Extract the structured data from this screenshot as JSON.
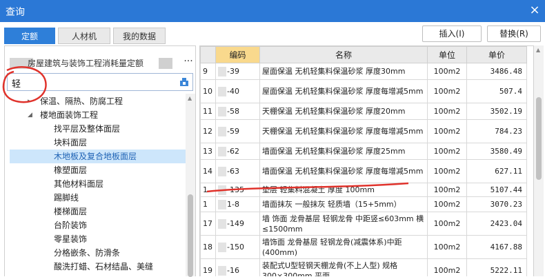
{
  "window": {
    "title": "查询",
    "close_glyph": "×"
  },
  "tabs": [
    {
      "label": "定额",
      "active": true
    },
    {
      "label": "人材机",
      "active": false
    },
    {
      "label": "我的数据",
      "active": false
    }
  ],
  "buttons": {
    "insert": "插入(I)",
    "replace": "替换(R)"
  },
  "library": {
    "name": "房屋建筑与装饰工程消耗量定额",
    "more": "···"
  },
  "search": {
    "value": "轻"
  },
  "tree": [
    {
      "label": "保温、隔热、防腐工程",
      "arrow": "▸"
    },
    {
      "label": "楼地面装饰工程",
      "arrow": "◢"
    },
    {
      "label": "找平层及整体面层"
    },
    {
      "label": "块料面层"
    },
    {
      "label": "木地板及复合地板面层"
    },
    {
      "label": "橡塑面层"
    },
    {
      "label": "其他材料面层"
    },
    {
      "label": "踢脚线"
    },
    {
      "label": "楼梯面层"
    },
    {
      "label": "台阶装饰"
    },
    {
      "label": "零星装饰"
    },
    {
      "label": "分格嵌条、防滑条"
    },
    {
      "label": "酸洗打蜡、石材结晶、美缝"
    }
  ],
  "table": {
    "columns": [
      "",
      "编码",
      "名称",
      "单位",
      "单价"
    ],
    "rows": [
      {
        "idx": "9",
        "code": "-39",
        "name": "屋面保温 无机轻集料保温砂浆 厚度30mm",
        "unit": "100m2",
        "price": "3486.48"
      },
      {
        "idx": "10",
        "code": "-40",
        "name": "屋面保温 无机轻集料保温砂浆 厚度每增减5mm",
        "unit": "100m2",
        "price": "507.4"
      },
      {
        "idx": "11",
        "code": "-58",
        "name": "天棚保温 无机轻集料保温砂浆 厚度20mm",
        "unit": "100m2",
        "price": "3502.19"
      },
      {
        "idx": "12",
        "code": "-59",
        "name": "天棚保温 无机轻集料保温砂浆 厚度每增减5mm",
        "unit": "100m2",
        "price": "784.23"
      },
      {
        "idx": "13",
        "code": "-62",
        "name": "墙面保温 无机轻集料保温砂浆 厚度25mm",
        "unit": "100m2",
        "price": "3580.49"
      },
      {
        "idx": "14",
        "code": "-63",
        "name": "墙面保温 无机轻集料保温砂浆 厚度每增减5mm",
        "unit": "100m2",
        "price": "627.11"
      },
      {
        "idx": "1",
        "code": "-135",
        "name": "垫层 轻集料混凝土 厚度 100mm",
        "unit": "100m2",
        "price": "5107.44"
      },
      {
        "idx": "1",
        "code": "1-8",
        "name": "墙面抹灰 一般抹灰 轻质墙（15+5mm）",
        "unit": "100m2",
        "price": "3070.23"
      },
      {
        "idx": "17",
        "code": "-149",
        "name": "墙 饰面 龙骨基层 轻钢龙骨 中距竖≤603mm 横≤1500mm",
        "unit": "100m2",
        "price": "2423.04"
      },
      {
        "idx": "18",
        "code": "-150",
        "name": "墙饰面 龙骨基层 轻钢龙骨(减震体系)中距(400mm)",
        "unit": "100m2",
        "price": "4167.88"
      },
      {
        "idx": "19",
        "code": "-16",
        "name": "装配式U型轻钢天棚龙骨(不上人型) 规格300×300mm 平面",
        "unit": "100m2",
        "price": "5222.11"
      }
    ]
  },
  "colors": {
    "titlebar": "#2b78d6",
    "tab_active": "#2e7fd9",
    "code_header": "#f9d98d",
    "annotation_red": "#e0322b",
    "selected_row": "#cde6fb"
  }
}
